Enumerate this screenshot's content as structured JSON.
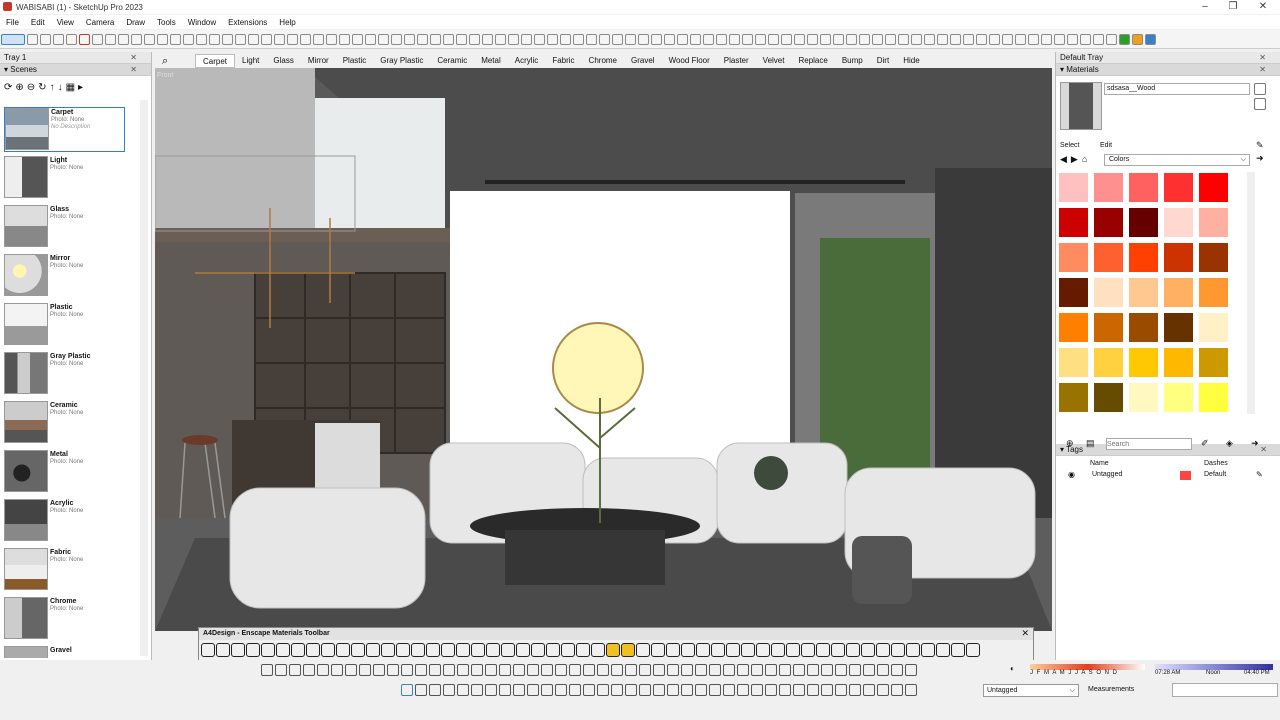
{
  "window": {
    "title": "WABISABI (1) - SketchUp Pro 2023",
    "minimize": "–",
    "restore": "❐",
    "close": "✕"
  },
  "menu": [
    "File",
    "Edit",
    "View",
    "Camera",
    "Draw",
    "Tools",
    "Window",
    "Extensions",
    "Help"
  ],
  "tray_left": {
    "title": "Tray 1",
    "panel_title": "Scenes",
    "close": "✕",
    "pin": "⊓"
  },
  "scenes": [
    {
      "name": "Carpet",
      "photo": "Photo: None",
      "desc": "No Description",
      "selected": true
    },
    {
      "name": "Light",
      "photo": "Photo: None"
    },
    {
      "name": "Glass",
      "photo": "Photo: None"
    },
    {
      "name": "Mirror",
      "photo": "Photo: None"
    },
    {
      "name": "Plastic",
      "photo": "Photo: None"
    },
    {
      "name": "Gray Plastic",
      "photo": "Photo: None"
    },
    {
      "name": "Ceramic",
      "photo": "Photo: None"
    },
    {
      "name": "Metal",
      "photo": "Photo: None"
    },
    {
      "name": "Acrylic",
      "photo": "Photo: None"
    },
    {
      "name": "Fabric",
      "photo": "Photo: None"
    },
    {
      "name": "Chrome",
      "photo": "Photo: None"
    },
    {
      "name": "Gravel",
      "photo": ""
    }
  ],
  "material_tabs": [
    "Carpet",
    "Light",
    "Glass",
    "Mirror",
    "Plastic",
    "Gray Plastic",
    "Ceramic",
    "Metal",
    "Acrylic",
    "Fabric",
    "Chrome",
    "Gravel",
    "Wood Floor",
    "Plaster",
    "Velvet",
    "Replace",
    "Bump",
    "Dirt",
    "Hide"
  ],
  "active_tab": "Carpet",
  "viewport": {
    "label": "Front"
  },
  "tray_right": {
    "title": "Default Tray",
    "materials": {
      "title": "Materials",
      "current_name": "sdsasa__Wood",
      "select_tab": "Select",
      "edit_tab": "Edit",
      "library": "Colors"
    },
    "swatches": [
      "#ffc0c0",
      "#ff9090",
      "#ff6060",
      "#ff3030",
      "#ff0000",
      "#cc0000",
      "#990000",
      "#660000",
      "#ffd8d0",
      "#ffb0a0",
      "#ff8c60",
      "#ff6030",
      "#ff4000",
      "#cc3300",
      "#993300",
      "#661a00",
      "#ffe0c0",
      "#ffc890",
      "#ffb060",
      "#ff9830",
      "#ff8000",
      "#cc6600",
      "#994c00",
      "#663300",
      "#fff0c8",
      "#ffe080",
      "#ffd040",
      "#ffc800",
      "#ffb800",
      "#cc9900",
      "#997300",
      "#664c00",
      "#fff8c0",
      "#ffff80",
      "#ffff40"
    ],
    "tags": {
      "title": "Tags",
      "search_placeholder": "Search",
      "col_name": "Name",
      "col_dashes": "Dashes",
      "rows": [
        {
          "name": "Untagged",
          "color": "#ff4444",
          "dashes": "Default"
        }
      ]
    }
  },
  "enscape": {
    "title": "A4Design - Enscape Materials Toolbar"
  },
  "bottom": {
    "tag_select": "Untagged",
    "measurements_label": "Measurements",
    "months": "J F M A M J J A S O N D",
    "time_start": "07:28 AM",
    "time_mid": "Noon",
    "time_end": "04:40 PM"
  }
}
